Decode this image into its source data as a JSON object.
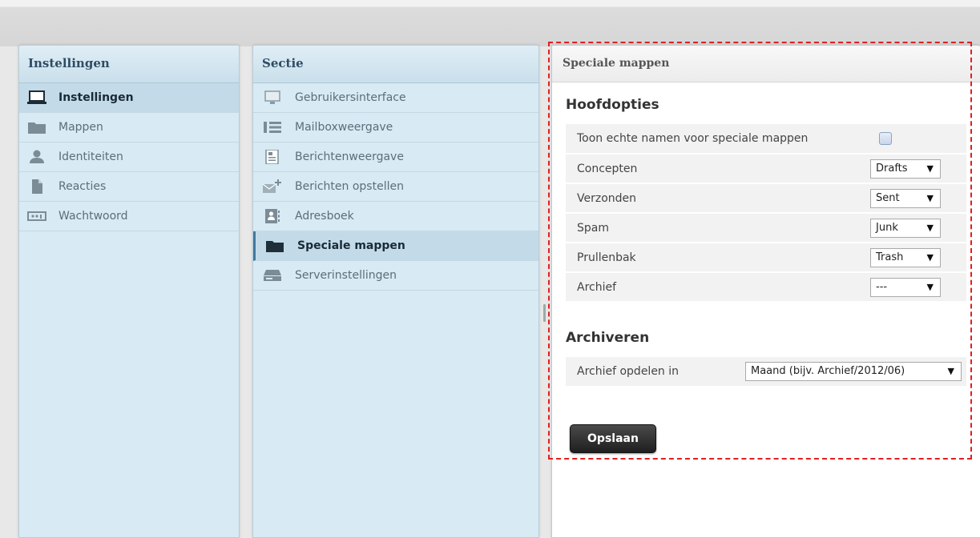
{
  "settings_panel": {
    "title": "Instellingen",
    "items": [
      {
        "label": "Instellingen",
        "icon": "laptop-icon",
        "active": true
      },
      {
        "label": "Mappen",
        "icon": "folder-icon",
        "active": false
      },
      {
        "label": "Identiteiten",
        "icon": "user-icon",
        "active": false
      },
      {
        "label": "Reacties",
        "icon": "document-icon",
        "active": false
      },
      {
        "label": "Wachtwoord",
        "icon": "password-icon",
        "active": false
      }
    ]
  },
  "section_panel": {
    "title": "Sectie",
    "items": [
      {
        "label": "Gebruikersinterface",
        "icon": "monitor-icon",
        "active": false
      },
      {
        "label": "Mailboxweergave",
        "icon": "list-icon",
        "active": false
      },
      {
        "label": "Berichtenweergave",
        "icon": "message-view-icon",
        "active": false
      },
      {
        "label": "Berichten opstellen",
        "icon": "compose-icon",
        "active": false
      },
      {
        "label": "Adresboek",
        "icon": "addressbook-icon",
        "active": false
      },
      {
        "label": "Speciale mappen",
        "icon": "folder-icon",
        "active": true
      },
      {
        "label": "Serverinstellingen",
        "icon": "server-icon",
        "active": false
      }
    ]
  },
  "content": {
    "title": "Speciale mappen",
    "main_heading": "Hoofdopties",
    "main_options": [
      {
        "label": "Toon echte namen voor speciale mappen",
        "type": "checkbox",
        "checked": false
      },
      {
        "label": "Concepten",
        "type": "select",
        "value": "Drafts"
      },
      {
        "label": "Verzonden",
        "type": "select",
        "value": "Sent"
      },
      {
        "label": "Spam",
        "type": "select",
        "value": "Junk"
      },
      {
        "label": "Prullenbak",
        "type": "select",
        "value": "Trash"
      },
      {
        "label": "Archief",
        "type": "select",
        "value": "---"
      }
    ],
    "archive_heading": "Archiveren",
    "archive_options": [
      {
        "label": "Archief opdelen in",
        "type": "select",
        "value": "Maand (bijv. Archief/2012/06)"
      }
    ],
    "save_label": "Opslaan"
  },
  "colors": {
    "panel_bg": "#d8eaf3",
    "active_item_bg": "#c3dbe8",
    "highlight_frame": "#e02020",
    "save_button": "#2b2b2b"
  }
}
